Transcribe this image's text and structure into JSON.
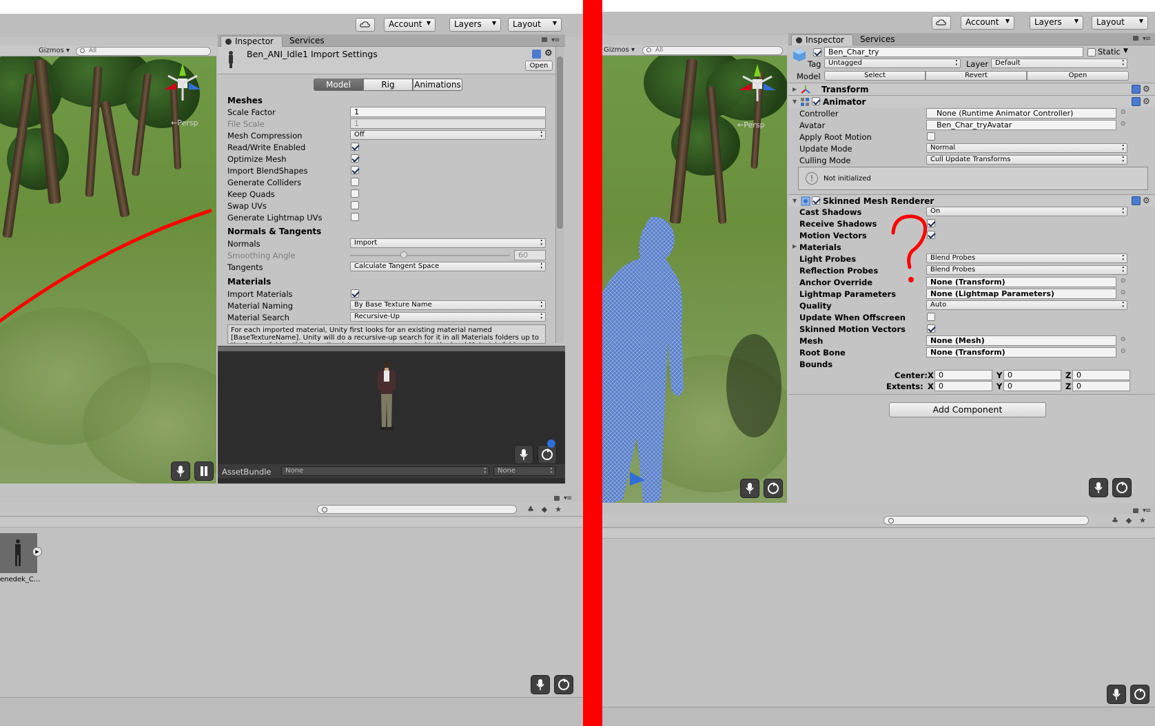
{
  "toolbar": {
    "account": "Account",
    "layers": "Layers",
    "layout": "Layout"
  },
  "scene": {
    "gizmos": "Gizmos",
    "search_placeholder": "All",
    "persp": "←Persp"
  },
  "inspector_tabs": {
    "inspector": "Inspector",
    "services": "Services"
  },
  "import_settings": {
    "title": "Ben_ANI_Idle1 Import Settings",
    "open": "Open",
    "tabs": [
      "Model",
      "Rig",
      "Animations"
    ],
    "meshes_header": "Meshes",
    "scale_factor": {
      "label": "Scale Factor",
      "value": "1"
    },
    "file_scale": {
      "label": "File Scale",
      "value": "1"
    },
    "mesh_compression": {
      "label": "Mesh Compression",
      "value": "Off"
    },
    "read_write": {
      "label": "Read/Write Enabled",
      "checked": true
    },
    "optimize_mesh": {
      "label": "Optimize Mesh",
      "checked": true
    },
    "import_blendshapes": {
      "label": "Import BlendShapes",
      "checked": true
    },
    "generate_colliders": {
      "label": "Generate Colliders",
      "checked": false
    },
    "keep_quads": {
      "label": "Keep Quads",
      "checked": false
    },
    "swap_uvs": {
      "label": "Swap UVs",
      "checked": false
    },
    "lightmap_uvs": {
      "label": "Generate Lightmap UVs",
      "checked": false
    },
    "normals_header": "Normals & Tangents",
    "normals": {
      "label": "Normals",
      "value": "Import"
    },
    "smoothing": {
      "label": "Smoothing Angle",
      "value": "60"
    },
    "tangents": {
      "label": "Tangents",
      "value": "Calculate Tangent Space"
    },
    "materials_header": "Materials",
    "import_materials": {
      "label": "Import Materials",
      "checked": true
    },
    "material_naming": {
      "label": "Material Naming",
      "value": "By Base Texture Name"
    },
    "material_search": {
      "label": "Material Search",
      "value": "Recursive-Up"
    },
    "help_text": "For each imported material, Unity first looks for an existing material named [BaseTextureName]. Unity will do a recursive-up search for it in all Materials folders up to the Assets folder. If it doesn't exist, a new one is created in the local Materials folder.",
    "asset_bundle": "AssetBundle",
    "ab_name": "None",
    "ab_variant": "None"
  },
  "asset": {
    "label": "enedek_C..."
  },
  "object_inspector": {
    "name": "Ben_Char_try",
    "static": "Static",
    "tag_label": "Tag",
    "tag": "Untagged",
    "layer_label": "Layer",
    "layer": "Default",
    "model_label": "Model",
    "select": "Select",
    "revert": "Revert",
    "open": "Open",
    "transform": "Transform",
    "animator": "Animator",
    "controller": {
      "label": "Controller",
      "value": "None (Runtime Animator Controller)"
    },
    "avatar": {
      "label": "Avatar",
      "value": "Ben_Char_tryAvatar"
    },
    "apply_root_motion": {
      "label": "Apply Root Motion",
      "checked": false
    },
    "update_mode": {
      "label": "Update Mode",
      "value": "Normal"
    },
    "culling_mode": {
      "label": "Culling Mode",
      "value": "Cull Update Transforms"
    },
    "not_initialized": "Not initialized",
    "smr": "Skinned Mesh Renderer",
    "cast_shadows": {
      "label": "Cast Shadows",
      "value": "On"
    },
    "receive_shadows": {
      "label": "Receive Shadows",
      "checked": true
    },
    "motion_vectors": {
      "label": "Motion Vectors",
      "checked": true
    },
    "materials": "Materials",
    "light_probes": {
      "label": "Light Probes",
      "value": "Blend Probes"
    },
    "reflection_probes": {
      "label": "Reflection Probes",
      "value": "Blend Probes"
    },
    "anchor_override": {
      "label": "Anchor Override",
      "value": "None (Transform)"
    },
    "lightmap_params": {
      "label": "Lightmap Parameters",
      "value": "None (Lightmap Parameters)"
    },
    "quality": {
      "label": "Quality",
      "value": "Auto"
    },
    "update_offscreen": {
      "label": "Update When Offscreen",
      "checked": false
    },
    "skinned_mv": {
      "label": "Skinned Motion Vectors",
      "checked": true
    },
    "mesh": {
      "label": "Mesh",
      "value": "None (Mesh)"
    },
    "root_bone": {
      "label": "Root Bone",
      "value": "None (Transform)"
    },
    "bounds": "Bounds",
    "center": {
      "label": "Center:",
      "x": "0",
      "y": "0",
      "z": "0"
    },
    "extents": {
      "label": "Extents:",
      "x": "0",
      "y": "0",
      "z": "0"
    },
    "axes": {
      "x": "X",
      "y": "Y",
      "z": "Z"
    },
    "add_component": "Add Component"
  },
  "colors": {
    "annotation_red": "#ff0000",
    "wireframe_blue": "#5b7fc7"
  }
}
